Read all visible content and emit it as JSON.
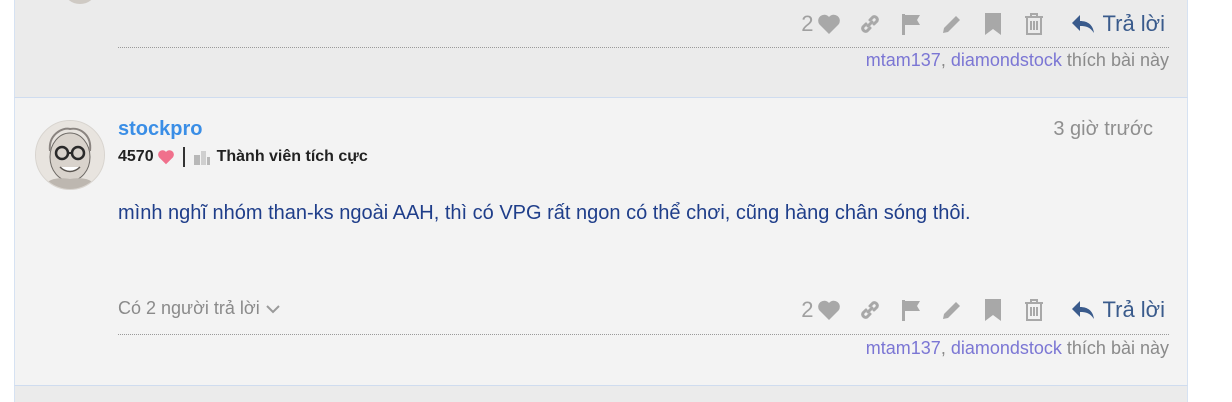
{
  "previous_post": {
    "like_count": "2",
    "reply_label": "Trả lời",
    "liked_by": [
      "mtam137",
      "diamondstock"
    ],
    "liked_suffix": "thích bài này"
  },
  "post": {
    "username": "stockpro",
    "time_ago": "3 giờ trước",
    "score": "4570",
    "rank": "Thành viên tích cực",
    "content": "mình nghĩ nhóm than-ks ngoài AAH, thì có VPG rất ngon có thể chơi, cũng hàng chân sóng thôi.",
    "replies_label": "Có 2 người trả lời",
    "like_count": "2",
    "reply_label": "Trả lời",
    "liked_by": [
      "mtam137",
      "diamondstock"
    ],
    "liked_suffix": "thích bài này"
  },
  "colors": {
    "username": "#3a8ee6",
    "content": "#1f3e8a",
    "liker": "#7b76d4",
    "reply": "#3a5b8c",
    "icon": "#a8a8a8"
  }
}
